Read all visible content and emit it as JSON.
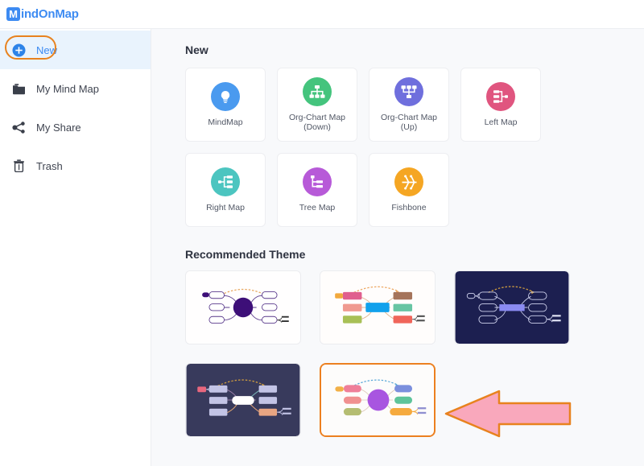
{
  "app": {
    "logo_badge": "M",
    "logo_text": "indOnMap",
    "brand_color": "#3d8bf2",
    "highlight_color": "#e8821e"
  },
  "sidebar": {
    "items": [
      {
        "label": "New",
        "icon": "plus-circle-icon",
        "active": true
      },
      {
        "label": "My Mind Map",
        "icon": "folder-icon",
        "active": false
      },
      {
        "label": "My Share",
        "icon": "share-nodes-icon",
        "active": false
      },
      {
        "label": "Trash",
        "icon": "trash-icon",
        "active": false
      }
    ]
  },
  "main": {
    "new_section": {
      "title": "New",
      "cards": [
        {
          "label": "MindMap",
          "icon": "lightbulb-icon",
          "color": "#4a9aef"
        },
        {
          "label": "Org-Chart Map (Down)",
          "icon": "org-chart-down-icon",
          "color": "#44c47d"
        },
        {
          "label": "Org-Chart Map (Up)",
          "icon": "org-chart-up-icon",
          "color": "#6f6fdd"
        },
        {
          "label": "Left Map",
          "icon": "left-map-icon",
          "color": "#e0557f"
        },
        {
          "label": "Right Map",
          "icon": "right-map-icon",
          "color": "#4cc5c0"
        },
        {
          "label": "Tree Map",
          "icon": "tree-map-icon",
          "color": "#b75ad8"
        },
        {
          "label": "Fishbone",
          "icon": "fishbone-icon",
          "color": "#f5a623"
        }
      ]
    },
    "theme_section": {
      "title": "Recommended Theme",
      "themes": [
        {
          "name": "light-purple-theme",
          "background": "#ffffff",
          "center": "#3d0f78",
          "selected": false
        },
        {
          "name": "colorful-rect-theme",
          "background": "#ffffff",
          "center": "#12a1ec",
          "selected": false
        },
        {
          "name": "dark-navy-theme",
          "background": "#1c1f50",
          "center": "#8b8bf2",
          "selected": false
        },
        {
          "name": "dark-slate-theme",
          "background": "#383a5c",
          "center": "#ffffff",
          "selected": false
        },
        {
          "name": "light-violet-theme",
          "background": "#fdfcfb",
          "center": "#a855e0",
          "selected": true
        }
      ]
    }
  },
  "annotation": {
    "arrow": "left-pointing-arrow",
    "fill": "#f9a8bc",
    "stroke": "#e8821e"
  }
}
